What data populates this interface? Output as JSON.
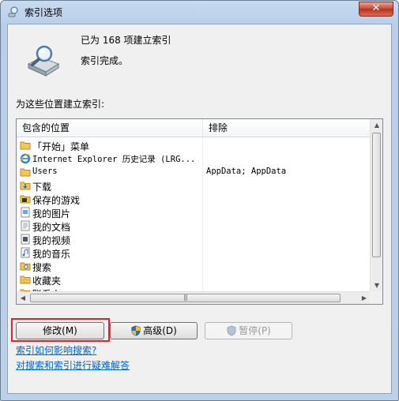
{
  "window": {
    "title": "索引选项",
    "close_label": "✕"
  },
  "status": {
    "count_text": "已为 168 项建立索引",
    "state_text": "索引完成。"
  },
  "section_label": "为这些位置建立索引:",
  "table": {
    "columns": [
      "包含的位置",
      "排除"
    ],
    "rows": [
      {
        "icon": "folder-icon",
        "name": "「开始」菜单",
        "exclude": ""
      },
      {
        "icon": "ie-icon",
        "name": "Internet Explorer 历史记录 (LRG...",
        "exclude": ""
      },
      {
        "icon": "folder-icon",
        "name": "Users",
        "exclude": "AppData; AppData"
      },
      {
        "icon": "download-icon",
        "name": "下载",
        "exclude": ""
      },
      {
        "icon": "games-icon",
        "name": "保存的游戏",
        "exclude": ""
      },
      {
        "icon": "pictures-icon",
        "name": "我的图片",
        "exclude": ""
      },
      {
        "icon": "documents-icon",
        "name": "我的文档",
        "exclude": ""
      },
      {
        "icon": "videos-icon",
        "name": "我的视频",
        "exclude": ""
      },
      {
        "icon": "music-icon",
        "name": "我的音乐",
        "exclude": ""
      },
      {
        "icon": "search-folder-icon",
        "name": "搜索",
        "exclude": ""
      },
      {
        "icon": "favorites-icon",
        "name": "收藏夹",
        "exclude": ""
      },
      {
        "icon": "contacts-icon",
        "name": "联系人",
        "exclude": ""
      }
    ]
  },
  "buttons": {
    "modify": "修改(M)",
    "advanced": "高级(D)",
    "pause": "暂停(P)"
  },
  "links": {
    "how_affects": "索引如何影响搜索?",
    "troubleshoot": "对搜索和索引进行疑难解答"
  },
  "colors": {
    "highlight": "#e0242c",
    "link": "#0066cc",
    "folder": "#f2c65a"
  }
}
